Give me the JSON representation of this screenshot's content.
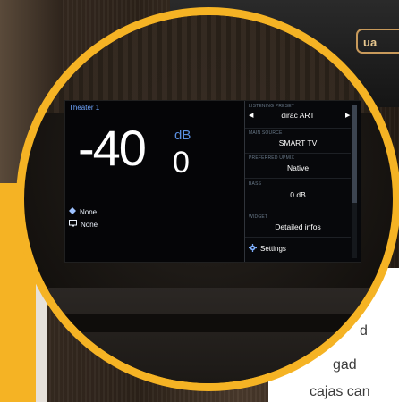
{
  "brand": {
    "badge_text": "ua"
  },
  "background_text": {
    "line1": "d",
    "line2": "gad",
    "line3": "cajas can"
  },
  "screen": {
    "profile_name": "Theater 1",
    "volume": {
      "integer": "-40",
      "decimal": "0",
      "unit": "dB"
    },
    "sources": [
      {
        "icon": "speaker-icon",
        "label": "None"
      },
      {
        "icon": "display-icon",
        "label": "None"
      }
    ],
    "side_panel": {
      "listening_preset": {
        "label": "LISTENING PRESET",
        "value": "dirac ART"
      },
      "main_source": {
        "label": "MAIN SOURCE",
        "value": "SMART TV"
      },
      "preferred_upmix": {
        "label": "PREFERRED UPMIX",
        "value": "Native"
      },
      "bass": {
        "label": "BASS",
        "value": "0 dB"
      },
      "widget": {
        "label": "WIDGET",
        "value": "Detailed infos"
      },
      "settings_label": "Settings"
    }
  },
  "colors": {
    "accent_ring": "#f5b324",
    "screen_accent": "#6fa6ff"
  }
}
